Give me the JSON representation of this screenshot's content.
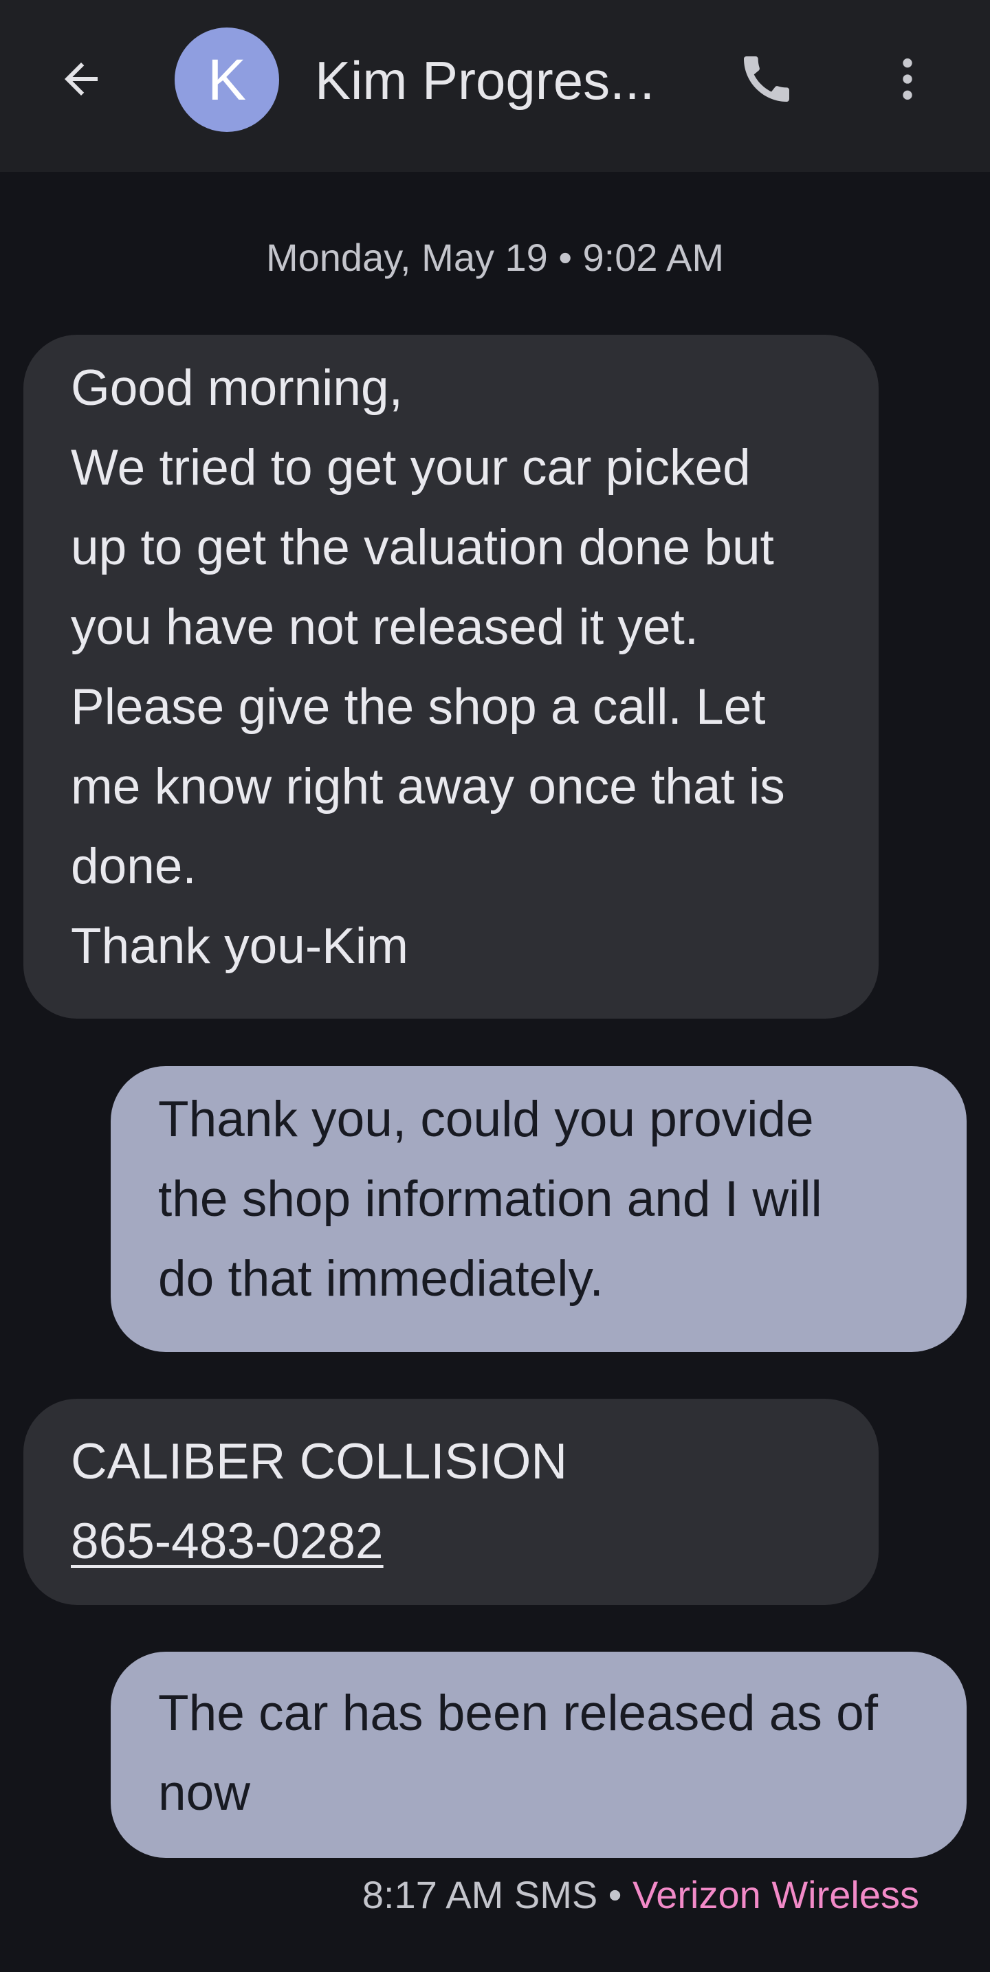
{
  "header": {
    "contact_initial": "K",
    "contact_name": "Kim Progres...",
    "back_icon": "arrow-left-icon",
    "call_icon": "phone-icon",
    "more_icon": "more-vertical-icon"
  },
  "conversation": {
    "date_header": "Monday, May 19 • 9:02 AM",
    "messages": [
      {
        "direction": "incoming",
        "lines": [
          "Good morning,",
          "We tried to get your car picked",
          "up to get the valuation done but",
          "you have not released it yet.",
          "Please give the shop a call. Let",
          "me know right away once that is",
          "done.",
          "Thank you-Kim"
        ]
      },
      {
        "direction": "outgoing",
        "lines": [
          "Thank you, could you provide",
          "the shop information and I will",
          "do that immediately."
        ]
      },
      {
        "direction": "incoming",
        "lines": [
          "CALIBER COLLISION",
          "865-483-0282"
        ]
      },
      {
        "direction": "outgoing",
        "lines": [
          "The car has been released as of",
          "now"
        ]
      }
    ],
    "status": {
      "time": "8:17 AM",
      "type": "SMS",
      "separator": "•",
      "carrier": "Verizon Wireless"
    }
  },
  "colors": {
    "background": "#131419",
    "topbar": "#1f2024",
    "incoming_bubble": "#2e2f34",
    "outgoing_bubble": "#a4a9c1",
    "avatar": "#8f9ee0",
    "carrier_accent": "#f28ac8"
  }
}
